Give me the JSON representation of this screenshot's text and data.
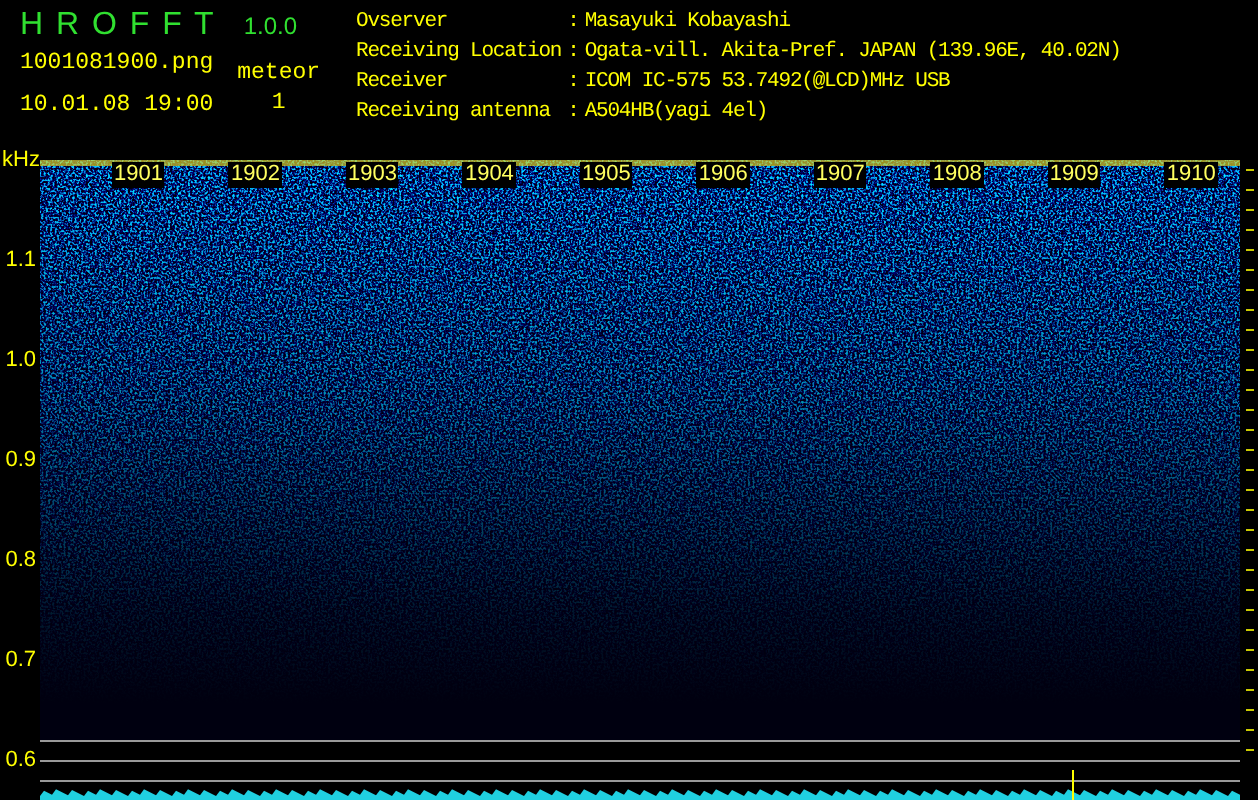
{
  "app": {
    "name": "H R O F F T",
    "version": "1.0.0"
  },
  "file": "1001081900.png",
  "datetime": "10.01.08 19:00",
  "meteor": {
    "label": "meteor",
    "count": "1"
  },
  "info": [
    {
      "label": "Ovserver",
      "sep": ":",
      "value": "Masayuki Kobayashi"
    },
    {
      "label": "Receiving Location",
      "sep": ":",
      "value": "Ogata-vill. Akita-Pref. JAPAN (139.96E, 40.02N)"
    },
    {
      "label": "Receiver",
      "sep": ":",
      "value": "ICOM IC-575 53.7492(@LCD)MHz USB"
    },
    {
      "label": "Receiving antenna",
      "sep": ":",
      "value": "A504HB(yagi 4el)"
    }
  ],
  "y_axis": {
    "unit": "kHz",
    "labels": [
      "1.1",
      "1.0",
      "0.9",
      "0.8",
      "0.7",
      "0.6"
    ]
  },
  "minute_labels": [
    "1901",
    "1902",
    "1903",
    "1904",
    "1905",
    "1906",
    "1907",
    "1908",
    "1909",
    "1910"
  ]
}
